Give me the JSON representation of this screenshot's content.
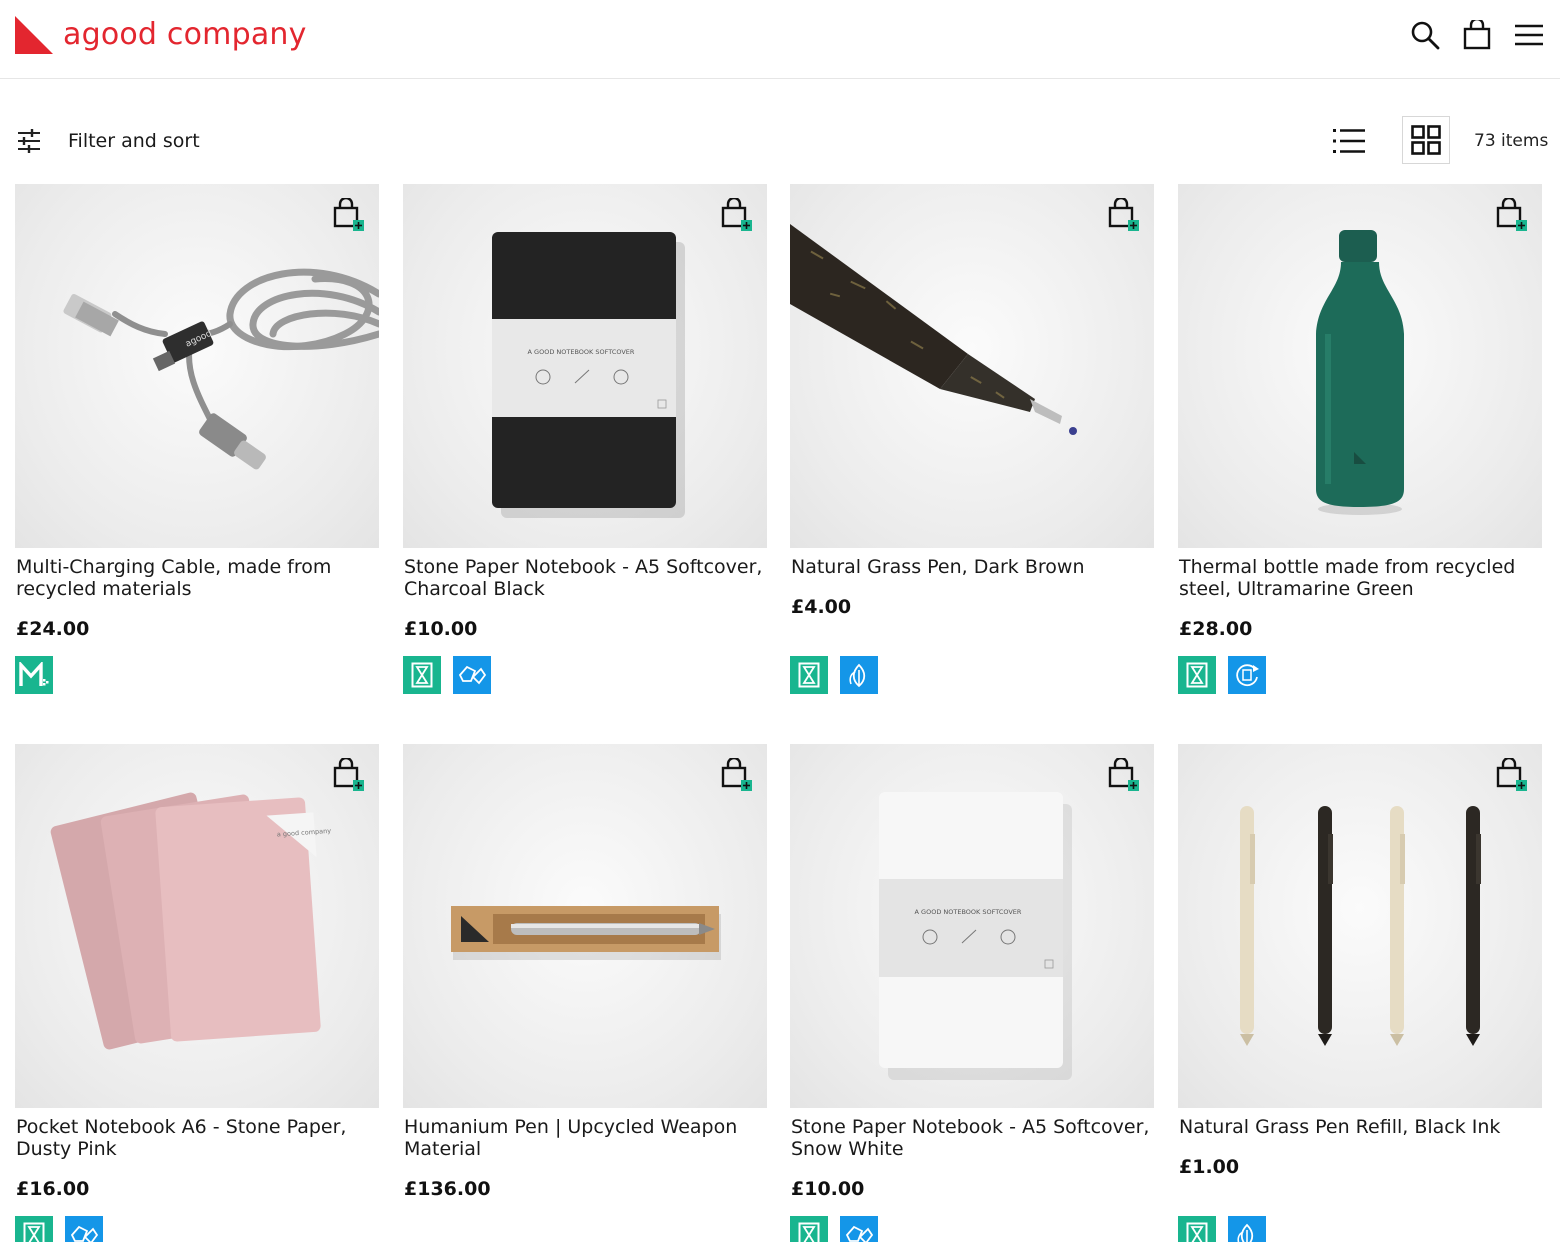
{
  "brand": {
    "name": "agood company",
    "color": "#e3262f"
  },
  "header": {
    "icons": [
      "search-icon",
      "shopping-bag-icon",
      "menu-icon"
    ]
  },
  "toolbar": {
    "filter_label": "Filter and sort",
    "item_count": "73 items",
    "active_view": "grid"
  },
  "products": [
    {
      "title": "Multi-Charging Cable, made from recycled materials",
      "price": "£24.00",
      "badges": [
        "green"
      ]
    },
    {
      "title": "Stone Paper Notebook - A5 Softcover, Charcoal Black",
      "price": "£10.00",
      "badges": [
        "green",
        "blue"
      ]
    },
    {
      "title": "Natural Grass Pen, Dark Brown",
      "price": "£4.00",
      "badges": [
        "green",
        "blue"
      ]
    },
    {
      "title": "Thermal bottle made from recycled steel, Ultramarine Green",
      "price": "£28.00",
      "badges": [
        "green",
        "blue"
      ]
    },
    {
      "title": "Pocket Notebook A6 - Stone Paper, Dusty Pink",
      "price": "£16.00",
      "badges": [
        "green",
        "blue"
      ]
    },
    {
      "title": "Humanium Pen | Upcycled Weapon Material",
      "price": "£136.00",
      "badges": []
    },
    {
      "title": "Stone Paper Notebook - A5 Softcover, Snow White",
      "price": "£10.00",
      "badges": [
        "green",
        "blue"
      ]
    },
    {
      "title": "Natural Grass Pen Refill, Black Ink",
      "price": "£1.00",
      "badges": [
        "green",
        "blue"
      ]
    }
  ],
  "notebook_band_text": "A GOOD NOTEBOOK SOFTCOVER",
  "cable_text": "agood",
  "pink_label_text": "a good company",
  "colors": {
    "badge_green": "#19b58f",
    "badge_blue": "#1496e8"
  }
}
